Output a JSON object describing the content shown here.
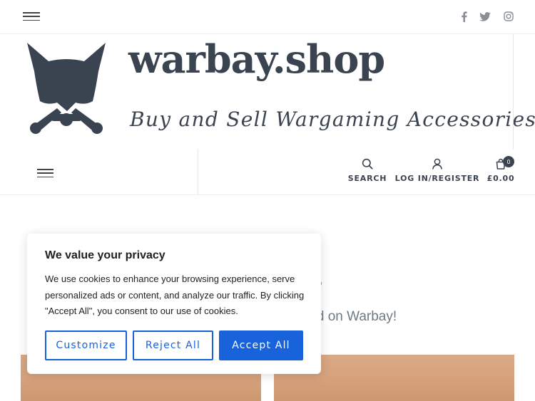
{
  "header": {
    "menu_icon": "hamburger-icon",
    "social": [
      {
        "icon": "facebook-icon"
      },
      {
        "icon": "twitter-icon"
      },
      {
        "icon": "instagram-icon"
      }
    ]
  },
  "brand": {
    "name": "warbay.shop",
    "tagline": "Buy and Sell Wargaming Accessories",
    "color": "#3a4350"
  },
  "nav": {
    "search_label": "SEARCH",
    "login_label": "LOG IN/REGISTER",
    "cart_total": "£0.00",
    "cart_count": "0"
  },
  "page": {
    "heading_fragment": "ls",
    "subheading_fragment": "ted on Warbay!"
  },
  "cookie": {
    "title": "We value your privacy",
    "body": "We use cookies to enhance your browsing experience, serve personalized ads or content, and analyze our traffic. By clicking \"Accept All\", you consent to our use of cookies.",
    "customize_label": "Customize",
    "reject_label": "Reject All",
    "accept_label": "Accept All",
    "accent": "#1863dc"
  }
}
